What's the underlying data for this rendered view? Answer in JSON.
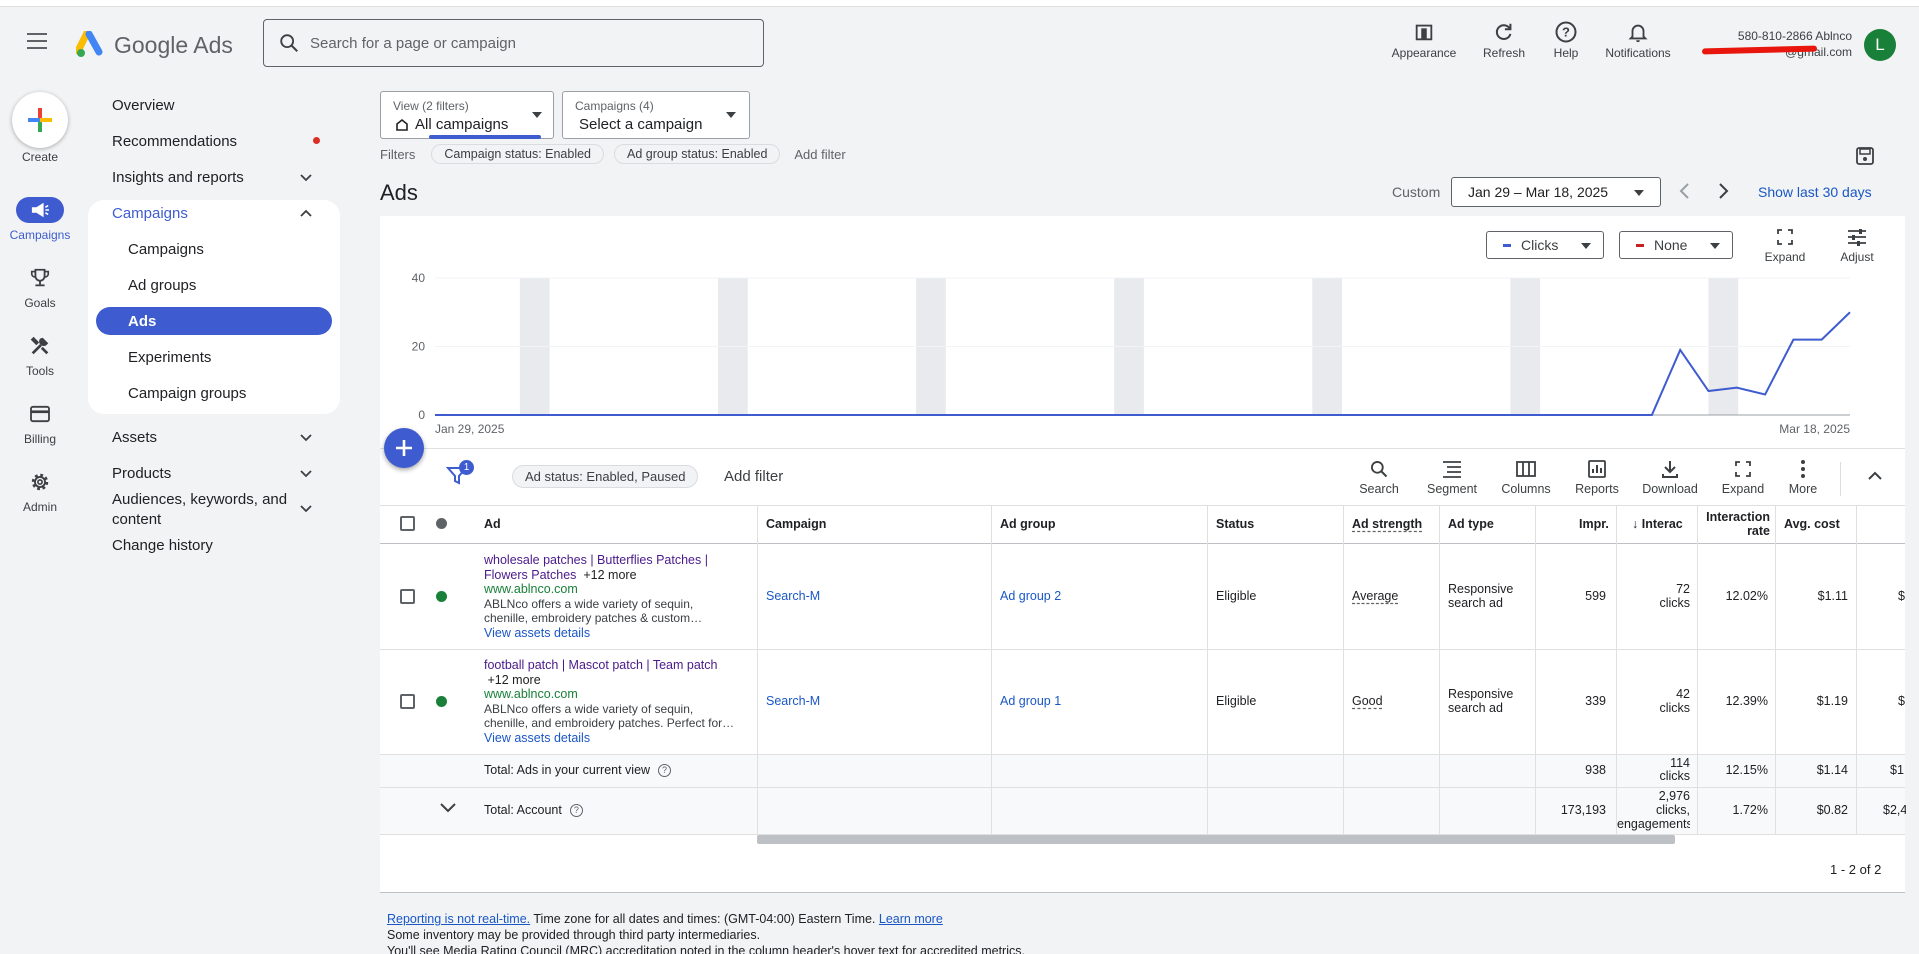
{
  "header": {
    "app_name": "Google Ads",
    "search_placeholder": "Search for a page or campaign",
    "tools": [
      {
        "label": "Appearance",
        "icon": "appearance-icon"
      },
      {
        "label": "Refresh",
        "icon": "refresh-icon"
      },
      {
        "label": "Help",
        "icon": "help-icon"
      },
      {
        "label": "Notifications",
        "icon": "bell-icon"
      }
    ],
    "account_phone": "580-810-2866 Ablnco",
    "account_email": "@gmail.com",
    "avatar_letter": "L"
  },
  "rail": {
    "create": "Create",
    "items": [
      {
        "label": "Campaigns",
        "icon": "megaphone-icon",
        "active": true
      },
      {
        "label": "Goals",
        "icon": "trophy-icon"
      },
      {
        "label": "Tools",
        "icon": "tools-icon"
      },
      {
        "label": "Billing",
        "icon": "credit-card-icon"
      },
      {
        "label": "Admin",
        "icon": "gear-icon"
      }
    ]
  },
  "nav": {
    "overview": "Overview",
    "recommendations": "Recommendations",
    "insights": "Insights and reports",
    "campaigns_group": "Campaigns",
    "sub": [
      "Campaigns",
      "Ad groups",
      "Ads",
      "Experiments",
      "Campaign groups"
    ],
    "assets": "Assets",
    "products": "Products",
    "audiences": "Audiences, keywords, and content",
    "change_history": "Change history"
  },
  "selectors": {
    "view_small": "View (2 filters)",
    "view_big": "All campaigns",
    "campaign_small": "Campaigns (4)",
    "campaign_big": "Select a campaign"
  },
  "filters": {
    "label": "Filters",
    "chips": [
      "Campaign status: Enabled",
      "Ad group status: Enabled"
    ],
    "add": "Add filter"
  },
  "page": {
    "title": "Ads",
    "custom": "Custom",
    "date_range": "Jan 29 – Mar 18, 2025",
    "show_last": "Show last 30 days"
  },
  "chart_controls": {
    "metric1": "Clicks",
    "metric1_color": "#3e5ccf",
    "metric2": "None",
    "metric2_color": "#c5221f",
    "expand": "Expand",
    "adjust": "Adjust"
  },
  "chart_data": {
    "type": "line",
    "series": [
      {
        "name": "Clicks",
        "color": "#3e5ccf",
        "values": [
          0,
          0,
          0,
          0,
          0,
          0,
          0,
          0,
          0,
          0,
          0,
          0,
          0,
          0,
          0,
          0,
          0,
          0,
          0,
          0,
          0,
          0,
          0,
          0,
          0,
          0,
          0,
          0,
          0,
          0,
          0,
          0,
          0,
          0,
          0,
          0,
          0,
          0,
          0,
          0,
          0,
          0,
          0,
          0,
          19,
          7,
          8,
          6,
          22,
          22,
          30
        ]
      }
    ],
    "x_start": "Jan 29, 2025",
    "x_end": "Mar 18, 2025",
    "y_ticks": [
      0,
      20,
      40
    ],
    "ylim": [
      0,
      40
    ],
    "weekend_bands": true
  },
  "table_toolbar": {
    "filter_badge": "1",
    "status_chip": "Ad status: Enabled, Paused",
    "add_filter": "Add filter",
    "tools": [
      {
        "label": "Search",
        "icon": "search-icon"
      },
      {
        "label": "Segment",
        "icon": "segment-icon"
      },
      {
        "label": "Columns",
        "icon": "columns-icon"
      },
      {
        "label": "Reports",
        "icon": "reports-icon"
      },
      {
        "label": "Download",
        "icon": "download-icon"
      },
      {
        "label": "Expand",
        "icon": "expand-icon"
      },
      {
        "label": "More",
        "icon": "more-icon"
      }
    ]
  },
  "table": {
    "headers": {
      "ad": "Ad",
      "campaign": "Campaign",
      "ad_group": "Ad group",
      "status": "Status",
      "ad_strength": "Ad strength",
      "ad_type": "Ad type",
      "impr": "Impr.",
      "interactions": "Interac",
      "interaction_rate_1": "Interaction",
      "interaction_rate_2": "rate",
      "avg_cost": "Avg. cost"
    },
    "rows": [
      {
        "headline_1": "wholesale patches | Butterflies Patches |",
        "headline_2": "Flowers Patches",
        "more": "+12 more",
        "url": "www.ablnco.com",
        "desc_1": "ABLNco offers a wide variety of sequin,",
        "desc_2": "chenille, embroidery patches & custom…",
        "assets_link": "View assets details",
        "campaign": "Search-M",
        "ad_group": "Ad group 2",
        "status": "Eligible",
        "ad_strength": "Average",
        "ad_type_1": "Responsive",
        "ad_type_2": "search ad",
        "impr": "599",
        "interactions_1": "72",
        "interactions_2": "clicks",
        "interaction_rate": "12.02%",
        "avg_cost": "$1.11",
        "cut": "$"
      },
      {
        "headline_1": "football patch | Mascot patch | Team patch",
        "headline_2": "",
        "more": "+12 more",
        "url": "www.ablnco.com",
        "desc_1": "ABLNco offers a wide variety of sequin,",
        "desc_2": "chenille, and embroidery patches. Perfect for…",
        "assets_link": "View assets details",
        "campaign": "Search-M",
        "ad_group": "Ad group 1",
        "status": "Eligible",
        "ad_strength": "Good",
        "ad_type_1": "Responsive",
        "ad_type_2": "search ad",
        "impr": "339",
        "interactions_1": "42",
        "interactions_2": "clicks",
        "interaction_rate": "12.39%",
        "avg_cost": "$1.19",
        "cut": "$"
      }
    ],
    "total_view": {
      "label": "Total: Ads in your current view",
      "impr": "938",
      "interactions_1": "114",
      "interactions_2": "clicks",
      "interaction_rate": "12.15%",
      "avg_cost": "$1.14",
      "cut": "$1"
    },
    "total_account": {
      "label": "Total: Account",
      "impr": "173,193",
      "interactions_1": "2,976",
      "interactions_2": "clicks,",
      "interactions_3": "engagements",
      "interaction_rate": "1.72%",
      "avg_cost": "$0.82",
      "cut": "$2,4"
    },
    "pager": "1 - 2 of 2"
  },
  "footer": {
    "link1": "Reporting is not real-time.",
    "text1": " Time zone for all dates and times: (GMT-04:00) Eastern Time. ",
    "link2": "Learn more",
    "line2": "Some inventory may be provided through third party intermediaries.",
    "line3": "You'll see Media Rating Council (MRC) accreditation noted in the column header's hover text for accredited metrics."
  }
}
